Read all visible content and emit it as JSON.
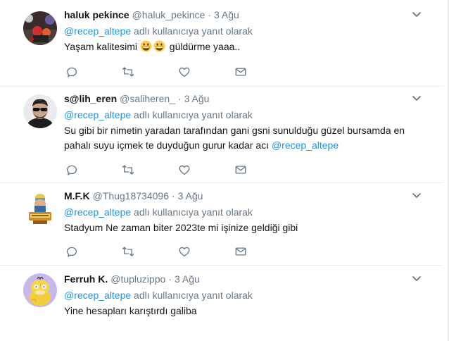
{
  "reply_prefix_suffix": " adlı kullanıcıya yanıt olarak",
  "tweets": [
    {
      "name": "haluk pekince",
      "handle": "@haluk_pekince",
      "time": "3 Ağu",
      "reply_to": "@recep_altepe",
      "text_before": "Yaşam kalitesimi ",
      "emojis": [
        "grinning-face-emoji",
        "grinning-face-emoji"
      ],
      "text_after": " güldürme yaaa..",
      "avatar": "dark-photo-avatar"
    },
    {
      "name": "s@lih_eren",
      "handle": "@saliheren_",
      "time": "3 Ağu",
      "reply_to": "@recep_altepe",
      "text": "Su gibi bir nimetin yaradan tarafından gani gsni sunulduğu güzel bursamda en pahalı suyu içmek te duyduğun gurur kadar acı ",
      "text_mention": "@recep_altepe",
      "avatar": "man-with-sunglasses-avatar"
    },
    {
      "name": "M.F.K",
      "handle": "@Thug18734096",
      "time": "3 Ağu",
      "reply_to": "@recep_altepe",
      "text": "Stadyum Ne zaman biter 2023te mi işinize geldiği gibi",
      "avatar": "cartoon-character-avatar"
    },
    {
      "name": "Ferruh K.",
      "handle": "@tupluzippo",
      "time": "3 Ağu",
      "reply_to": "@recep_altepe",
      "text": "Yine hesapları karıştırdı galiba",
      "avatar": "psyduck-avatar"
    }
  ],
  "colors": {
    "link": "#1b95e0",
    "secondary_text": "#657786",
    "primary_text": "#14171a",
    "border": "#e6ecf0"
  }
}
